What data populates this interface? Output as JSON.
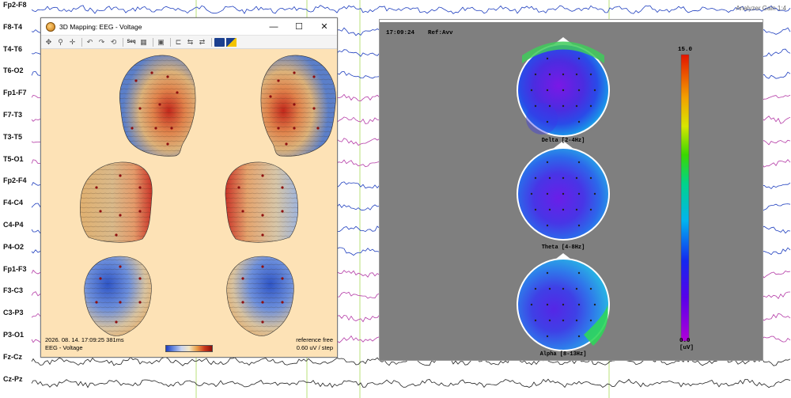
{
  "channels": [
    "Fp2-F8",
    "F8-T4",
    "T4-T6",
    "T6-O2",
    "Fp1-F7",
    "F7-T3",
    "T3-T5",
    "T5-O1",
    "Fp2-F4",
    "F4-C4",
    "C4-P4",
    "P4-O2",
    "Fp1-F3",
    "F3-C3",
    "C3-P3",
    "P3-O1",
    "Fz-Cz",
    "Cz-Pz"
  ],
  "status_text": "Analyzer Gain 1:4",
  "window3d": {
    "title": "3D Mapping: EEG - Voltage",
    "minimize": "—",
    "maximize": "☐",
    "close": "✕",
    "toolbar": {
      "seq": "Seq"
    },
    "timestamp": "2026. 08. 14. 17:09:25 381ms",
    "mode": "EEG - Voltage",
    "reference": "reference free",
    "scale": "0.60 uV / step"
  },
  "topomap": {
    "time": "17:09:24",
    "ref": "Ref:Avv",
    "bands": [
      "Delta [2-4Hz]",
      "Theta [4-8Hz]",
      "Alpha [8-13Hz]"
    ],
    "colorbar": {
      "max": "15.0",
      "min": "0.0",
      "unit": "[uV]"
    }
  }
}
